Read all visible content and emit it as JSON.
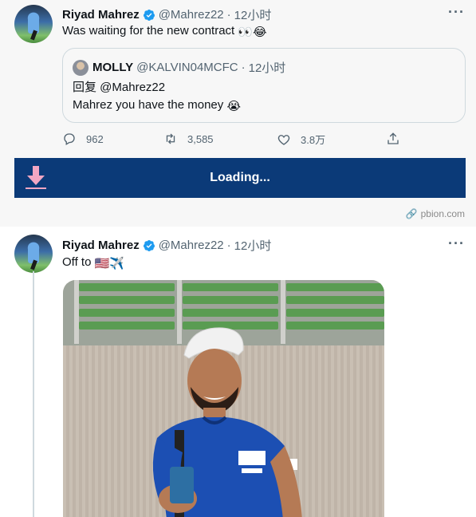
{
  "tweet1": {
    "name": "Riyad Mahrez",
    "handle": "@Mahrez22",
    "separator": "·",
    "time": "12小时",
    "text": "Was waiting for the new contract",
    "text_emoji": "👀😂",
    "quote": {
      "name": "MOLLY",
      "handle": "@KALVIN04MCFC",
      "separator": "·",
      "time": "12小时",
      "reply_to": "回复 @Mahrez22",
      "text": "Mahrez you have the money",
      "text_emoji": "😭"
    },
    "actions": {
      "replies": "962",
      "retweets": "3,585",
      "likes": "3.8万"
    }
  },
  "banner": {
    "loading": "Loading..."
  },
  "attribution": {
    "icon": "link-icon",
    "text": "pbion.com"
  },
  "tweet2": {
    "name": "Riyad Mahrez",
    "handle": "@Mahrez22",
    "separator": "·",
    "time": "12小时",
    "text": "Off to",
    "text_emoji": "🇺🇸✈️"
  },
  "colors": {
    "verified": "#1d9bf0",
    "banner": "#0b3a78",
    "secondary_text": "#536471"
  }
}
